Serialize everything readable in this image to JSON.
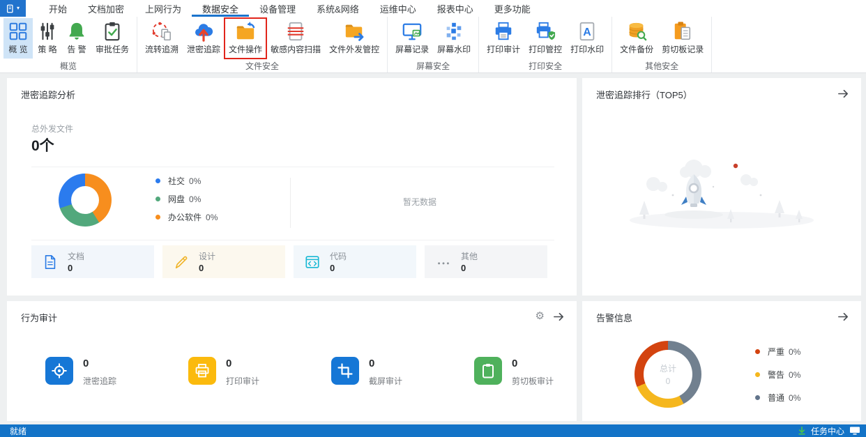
{
  "menu": {
    "items": [
      "开始",
      "文档加密",
      "上网行为",
      "数据安全",
      "设备管理",
      "系统&网络",
      "运维中心",
      "报表中心",
      "更多功能"
    ],
    "active_item": "数据安全"
  },
  "ribbon": {
    "groups": [
      {
        "label": "概览",
        "items": [
          {
            "label": "概 览"
          },
          {
            "label": "策 略"
          },
          {
            "label": "告 警"
          },
          {
            "label": "审批任务"
          }
        ]
      },
      {
        "label": "文件安全",
        "items": [
          {
            "label": "流转追溯"
          },
          {
            "label": "泄密追踪"
          },
          {
            "label": "文件操作"
          },
          {
            "label": "敏感内容扫描"
          },
          {
            "label": "文件外发管控"
          }
        ]
      },
      {
        "label": "屏幕安全",
        "items": [
          {
            "label": "屏幕记录"
          },
          {
            "label": "屏幕水印"
          }
        ]
      },
      {
        "label": "打印安全",
        "items": [
          {
            "label": "打印审计"
          },
          {
            "label": "打印管控"
          },
          {
            "label": "打印水印"
          }
        ]
      },
      {
        "label": "其他安全",
        "items": [
          {
            "label": "文件备份"
          },
          {
            "label": "剪切板记录"
          }
        ]
      }
    ],
    "highlighted_item": "文件操作"
  },
  "panels": {
    "trace_analysis": {
      "title": "泄密追踪分析",
      "total_label": "总外发文件",
      "total_value": "0个",
      "no_data_text": "暂无数据",
      "category_cards": [
        {
          "label": "文档",
          "value": "0"
        },
        {
          "label": "设计",
          "value": "0"
        },
        {
          "label": "代码",
          "value": "0"
        },
        {
          "label": "其他",
          "value": "0"
        }
      ]
    },
    "trace_ranking": {
      "title": "泄密追踪排行（TOP5）"
    },
    "behavior_audit": {
      "title": "行为审计",
      "stats": [
        {
          "label": "泄密追踪",
          "value": "0",
          "color": "#1677d6"
        },
        {
          "label": "打印审计",
          "value": "0",
          "color": "#fbba0d"
        },
        {
          "label": "截屏审计",
          "value": "0",
          "color": "#1677d6"
        },
        {
          "label": "剪切板审计",
          "value": "0",
          "color": "#4fb15c"
        }
      ]
    },
    "alert_info": {
      "title": "告警信息"
    }
  },
  "chart_data": [
    {
      "type": "pie",
      "title": "泄密追踪分析",
      "labels": [
        "社交",
        "网盘",
        "办公软件"
      ],
      "values": [
        0,
        0,
        0
      ],
      "legend": [
        {
          "label": "社交",
          "percent": "0%",
          "color": "#2b7bee"
        },
        {
          "label": "网盘",
          "percent": "0%",
          "color": "#52a87c"
        },
        {
          "label": "办公软件",
          "percent": "0%",
          "color": "#f78e1e"
        }
      ],
      "legend_position": "right",
      "ring_segments": [
        {
          "color": "#f78e1e",
          "sweep_deg": 148
        },
        {
          "color": "#52a87c",
          "sweep_deg": 104
        },
        {
          "color": "#2b7bee",
          "sweep_deg": 108
        }
      ]
    },
    {
      "type": "pie",
      "title": "告警信息",
      "labels": [
        "严重",
        "警告",
        "普通"
      ],
      "values": [
        0,
        0,
        0
      ],
      "center_label": "总计",
      "center_value": "0",
      "legend": [
        {
          "label": "严重",
          "percent": "0%",
          "color": "#d3430f"
        },
        {
          "label": "警告",
          "percent": "0%",
          "color": "#f5b71e"
        },
        {
          "label": "普通",
          "percent": "0%",
          "color": "#62748b"
        }
      ],
      "legend_position": "right",
      "ring_segments": [
        {
          "color": "#71808f",
          "sweep_deg": 152
        },
        {
          "color": "#f5b71e",
          "sweep_deg": 96
        },
        {
          "color": "#d3430f",
          "sweep_deg": 112
        }
      ]
    }
  ],
  "status_bar": {
    "left_text": "就绪",
    "task_center_label": "任务中心"
  },
  "colors": {
    "accent_blue": "#1b74cc",
    "highlight_box_red": "#e1251b",
    "selected_tab_bg": "#cfe4f7"
  }
}
